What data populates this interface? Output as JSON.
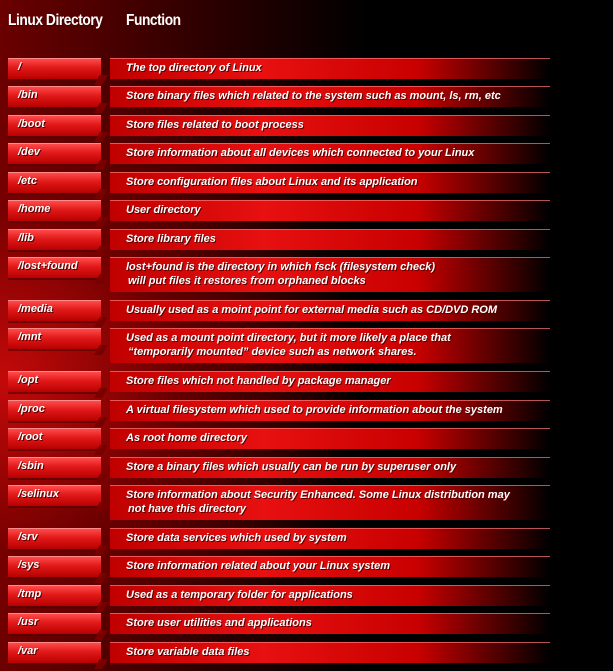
{
  "header": {
    "directory_label": "Linux Directory",
    "function_label": "Function"
  },
  "rows": [
    {
      "dir": "/",
      "fn": "The top directory of Linux"
    },
    {
      "dir": "/bin",
      "fn": "Store binary files which related to the system such as mount, ls, rm, etc"
    },
    {
      "dir": "/boot",
      "fn": "Store files related to boot process"
    },
    {
      "dir": "/dev",
      "fn": "Store information about all devices which connected to your Linux"
    },
    {
      "dir": "/etc",
      "fn": "Store configuration files about Linux and its application"
    },
    {
      "dir": "/home",
      "fn": "User directory"
    },
    {
      "dir": "/lib",
      "fn": "Store library files"
    },
    {
      "dir": "/lost+found",
      "fn": "lost+found is the directory in which fsck (filesystem check)",
      "fn2": "will put files it restores from orphaned blocks"
    },
    {
      "dir": "/media",
      "fn": "Usually used as a moint point for external media such as CD/DVD ROM"
    },
    {
      "dir": "/mnt",
      "fn": "Used as a mount point directory, but it more likely a place that",
      "fn2": "“temporarily mounted” device such as network shares."
    },
    {
      "dir": "/opt",
      "fn": "Store files which not handled by package manager"
    },
    {
      "dir": "/proc",
      "fn": "A virtual filesystem which used to provide information about the system"
    },
    {
      "dir": "/root",
      "fn": "As root home directory"
    },
    {
      "dir": "/sbin",
      "fn": "Store a binary files which usually can be run by superuser only"
    },
    {
      "dir": "/selinux",
      "fn": "Store information about Security Enhanced. Some Linux distribution may",
      "fn2": "not have this directory"
    },
    {
      "dir": "/srv",
      "fn": "Store data services which used by system"
    },
    {
      "dir": "/sys",
      "fn": "Store information related about your Linux system"
    },
    {
      "dir": "/tmp",
      "fn": "Used as a temporary folder for applications"
    },
    {
      "dir": "/usr",
      "fn": "Store user utilities and applications"
    },
    {
      "dir": "/var",
      "fn": "Store variable data files"
    }
  ]
}
